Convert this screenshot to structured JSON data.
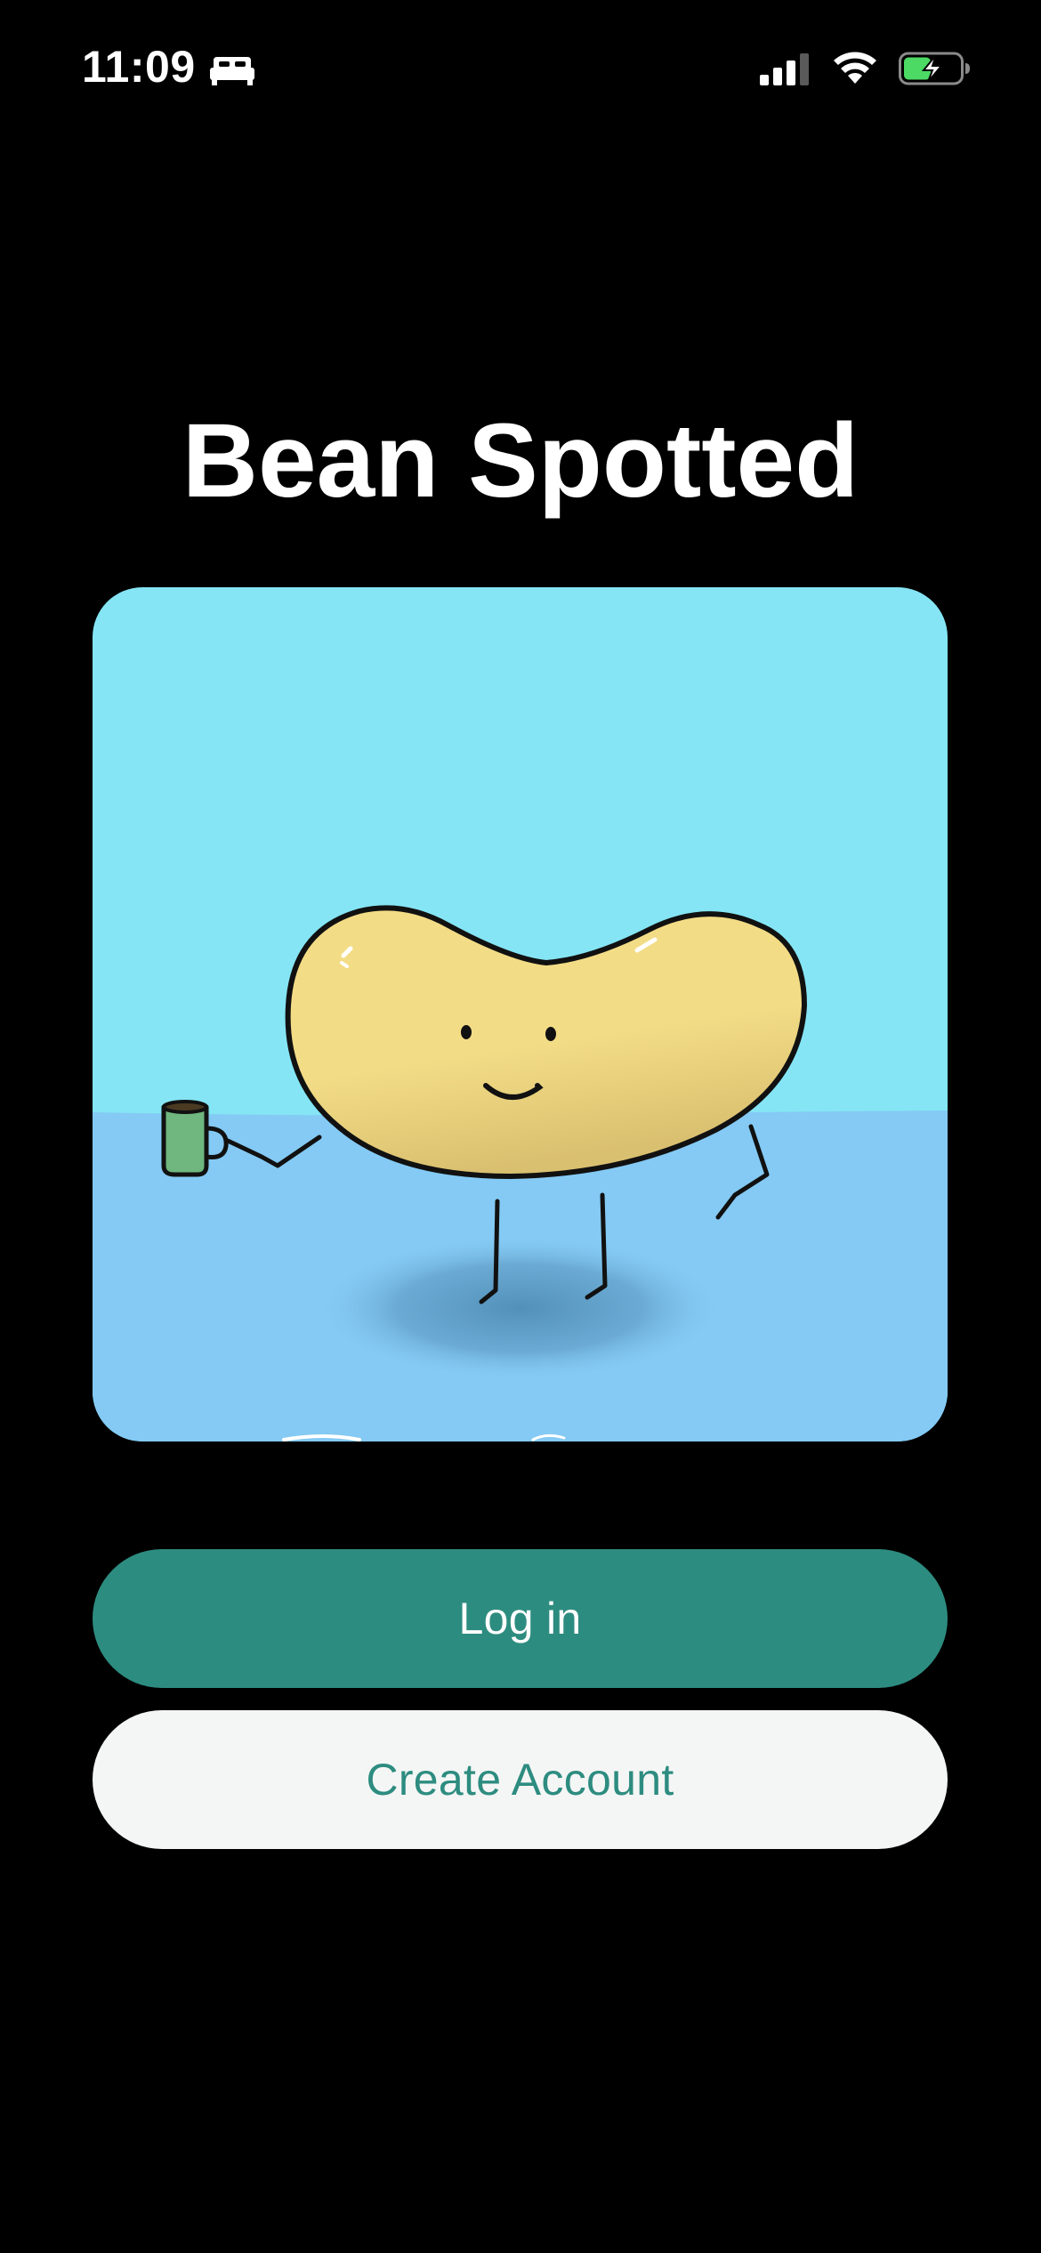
{
  "status_bar": {
    "time": "11:09",
    "icons": [
      "sleep-icon",
      "cellular-signal-icon",
      "wifi-icon",
      "battery-charging-icon"
    ]
  },
  "app": {
    "title": "Bean Spotted"
  },
  "hero": {
    "illustration": "bean-character-holding-mug-icon"
  },
  "actions": {
    "login_label": "Log in",
    "create_account_label": "Create Account"
  },
  "colors": {
    "background": "#000000",
    "accent": "#2d8c80",
    "secondary_button": "#f4f6f5",
    "sky": "#85e5f4",
    "floor": "#84caf4",
    "bean": "#f3dc86",
    "battery_charge": "#4cd964"
  }
}
